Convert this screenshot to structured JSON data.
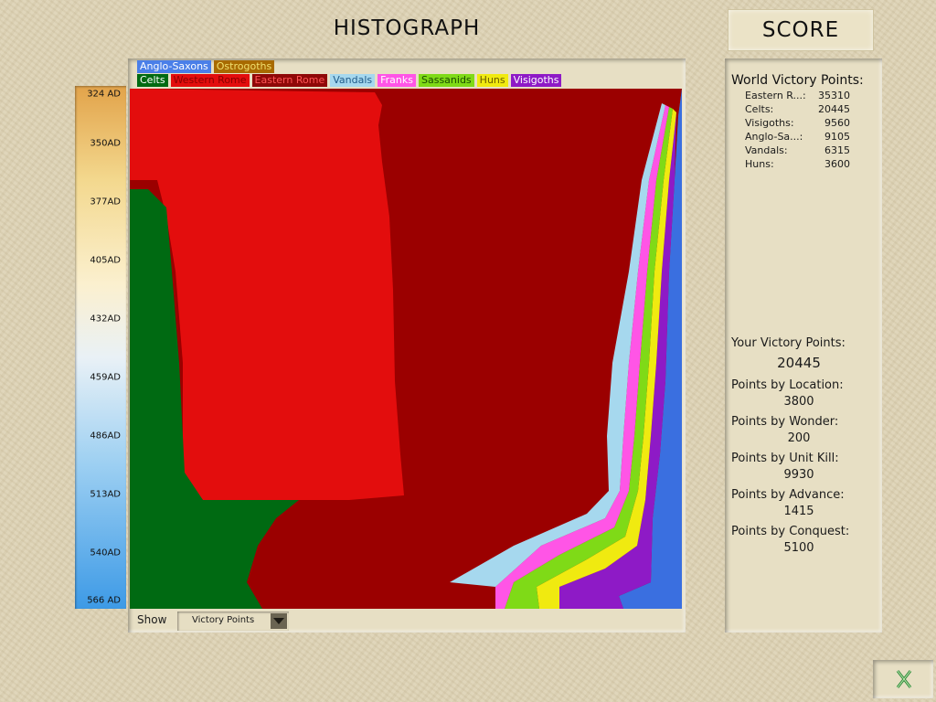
{
  "header": {
    "title": "HISTOGRAPH",
    "score_tab": "SCORE"
  },
  "legend": {
    "row1": [
      {
        "label": "Anglo-Saxons",
        "bg": "#4a7fe8",
        "fg": "#ffffff"
      },
      {
        "label": "Ostrogoths",
        "bg": "#a86a00",
        "fg": "#f0e070"
      }
    ],
    "row2": [
      {
        "label": "Celts",
        "bg": "#006a12",
        "fg": "#ffffff"
      },
      {
        "label": "Western Rome",
        "bg": "#e30d0d",
        "fg": "#8a0000"
      },
      {
        "label": "Eastern Rome",
        "bg": "#8f0808",
        "fg": "#ff5555"
      },
      {
        "label": "Vandals",
        "bg": "#a6d8ee",
        "fg": "#1f5a88"
      },
      {
        "label": "Franks",
        "bg": "#ff55e6",
        "fg": "#ffffff"
      },
      {
        "label": "Sassanids",
        "bg": "#7fda17",
        "fg": "#1a4a00"
      },
      {
        "label": "Huns",
        "bg": "#f0ea10",
        "fg": "#6a5a00"
      },
      {
        "label": "Visigoths",
        "bg": "#8e1ac6",
        "fg": "#ffffff"
      }
    ]
  },
  "timeline": {
    "ticks": [
      "324 AD",
      "350AD",
      "377AD",
      "405AD",
      "432AD",
      "459AD",
      "486AD",
      "513AD",
      "540AD",
      "566 AD"
    ]
  },
  "colors": {
    "eastern_rome": "#9b0000",
    "western_rome": "#e30d0d",
    "celts": "#006a12",
    "vandals": "#a6d8ee",
    "franks": "#ff55e6",
    "sassanids": "#7fda17",
    "huns": "#f0ea10",
    "visigoths": "#8e1ac6",
    "anglo_saxons": "#3a6fe0",
    "ostrogoths": "#a86a00"
  },
  "show": {
    "label": "Show",
    "value": "Victory Points"
  },
  "world": {
    "heading": "World Victory Points:",
    "rows": [
      {
        "name": "Eastern R...:",
        "value": "35310"
      },
      {
        "name": "Celts:",
        "value": "20445"
      },
      {
        "name": "Visigoths:",
        "value": "9560"
      },
      {
        "name": "Anglo-Sa...:",
        "value": "9105"
      },
      {
        "name": "Vandals:",
        "value": "6315"
      },
      {
        "name": "Huns:",
        "value": "3600"
      }
    ]
  },
  "your": {
    "heading": "Your Victory Points:",
    "total": "20445",
    "location_label": "Points by Location:",
    "location_value": "3800",
    "wonder_label": "Points by Wonder:",
    "wonder_value": "200",
    "unitkill_label": "Points by Unit Kill:",
    "unitkill_value": "9930",
    "advance_label": "Points by Advance:",
    "advance_value": "1415",
    "conquest_label": "Points by Conquest:",
    "conquest_value": "5100"
  },
  "exit": {
    "icon": "exit-icon"
  }
}
